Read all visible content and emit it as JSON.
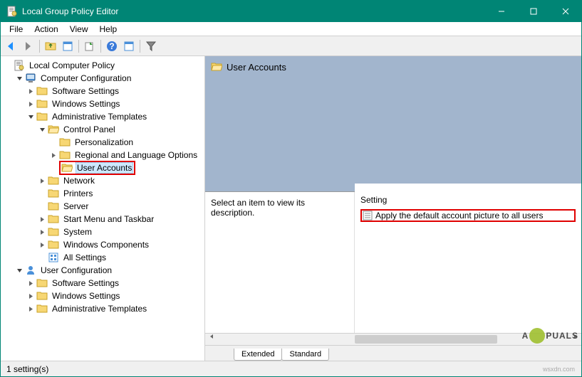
{
  "window": {
    "title": "Local Group Policy Editor"
  },
  "menu": {
    "file": "File",
    "action": "Action",
    "view": "View",
    "help": "Help"
  },
  "tree": {
    "root": "Local Computer Policy",
    "computer_config": "Computer Configuration",
    "software_settings": "Software Settings",
    "windows_settings": "Windows Settings",
    "admin_templates": "Administrative Templates",
    "control_panel": "Control Panel",
    "personalization": "Personalization",
    "regional": "Regional and Language Options",
    "user_accounts": "User Accounts",
    "network": "Network",
    "printers": "Printers",
    "server": "Server",
    "start_menu": "Start Menu and Taskbar",
    "system": "System",
    "windows_components": "Windows Components",
    "all_settings": "All Settings",
    "user_config": "User Configuration",
    "u_software_settings": "Software Settings",
    "u_windows_settings": "Windows Settings",
    "u_admin_templates": "Administrative Templates"
  },
  "right": {
    "header": "User Accounts",
    "description_prompt": "Select an item to view its description.",
    "setting_header": "Setting",
    "settings": [
      {
        "label": "Apply the default account picture to all users"
      }
    ]
  },
  "tabs": {
    "extended": "Extended",
    "standard": "Standard"
  },
  "status": {
    "text": "1 setting(s)"
  },
  "watermark": {
    "left": "A",
    "right": "PUALS",
    "site": "wsxdn.com"
  }
}
